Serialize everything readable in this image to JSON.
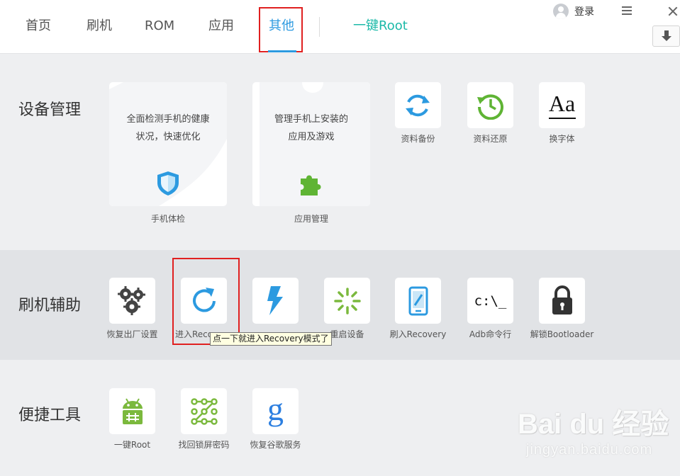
{
  "nav": {
    "tabs": [
      "首页",
      "刷机",
      "ROM",
      "应用",
      "其他"
    ],
    "root_tab": "一键Root",
    "active_tab": "其他"
  },
  "header": {
    "login_label": "登录"
  },
  "sections": {
    "device": {
      "title": "设备管理",
      "health_card": {
        "line1": "全面检测手机的健康",
        "line2": "状况，快速优化",
        "label": "手机体检"
      },
      "apps_card": {
        "line1": "管理手机上安装的",
        "line2": "应用及游戏",
        "label": "应用管理"
      },
      "backup_label": "资料备份",
      "restore_label": "资料还原",
      "font_label": "换字体",
      "font_glyph": "Aa"
    },
    "flash": {
      "title": "刷机辅助",
      "factory_reset_label": "恢复出厂设置",
      "enter_recovery_label": "进入Reco",
      "reboot_label": "重启设备",
      "flash_recovery_label": "刷入Recovery",
      "adb_label": "Adb命令行",
      "adb_glyph": "c:\\_",
      "bootloader_label": "解锁Bootloader",
      "tooltip": "点一下就进入Recovery模式了"
    },
    "tools": {
      "title": "便捷工具",
      "root_label": "一键Root",
      "pattern_label": "找回锁屏密码",
      "google_label": "恢复谷歌服务",
      "google_glyph": "g"
    }
  },
  "watermark": {
    "brand": "Bai du 经验",
    "sub": "jingyan.baidu.com"
  },
  "colors": {
    "accent_blue": "#2c9ae0",
    "root_green": "#1cb9a8",
    "highlight_red": "#e02020",
    "icon_green": "#7bb93d"
  }
}
